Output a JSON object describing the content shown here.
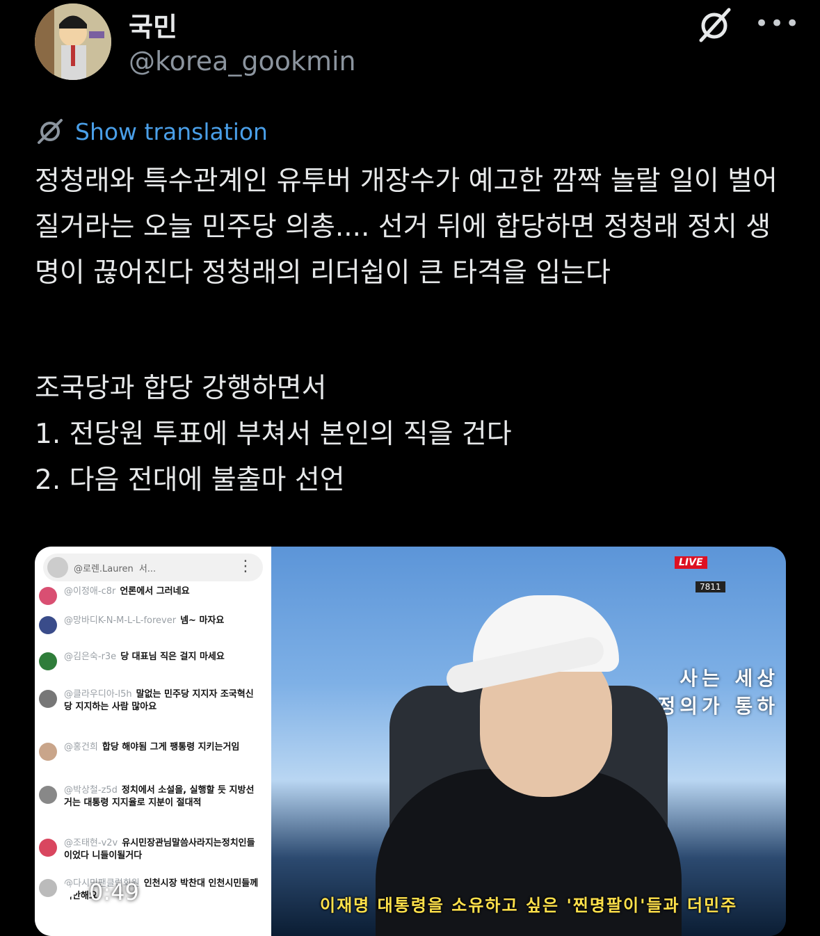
{
  "header": {
    "display_name": "국민",
    "handle": "@korea_gookmin",
    "more_icon": "more-dots-icon",
    "grok_icon": "grok-icon"
  },
  "translate": {
    "icon": "translate-icon",
    "label": "Show translation"
  },
  "tweet": {
    "paragraph1": "정청래와 특수관계인 유투버 개장수가 예고한 깜짝 놀랄 일이 벌어질거라는 오늘 민주당 의총.... 선거 뒤에 합당하면 정청래 정치 생명이 끊어진다 정청래의 리더쉽이 큰 타격을 입는다",
    "paragraph2_line1": "조국당과 합당 강행하면서",
    "paragraph2_line2": "1. 전당원 투표에 부쳐서 본인의 직을 건다",
    "paragraph2_line3": "2. 다음 전대에 불출마 선언"
  },
  "media": {
    "duration": "0:49",
    "chat": {
      "header_user": "@로렌.Lauren",
      "header_suffix": "서...",
      "messages": [
        {
          "user": "@이정애-c8r",
          "text": "언론에서 그러네요",
          "color": "#d94f72"
        },
        {
          "user": "@망바디K-N-M-L-L-forever",
          "text": "넴~ 마자요",
          "color": "#3a4c8a"
        },
        {
          "user": "@김은숙-r3e",
          "text": "당 대표님 직은 걸지 마세요",
          "color": "#2f7d3a"
        },
        {
          "user": "@클라우디아-l5h",
          "text": "말없는 민주당 지지자 조국혁신당 지지하는 사람 많아요",
          "color": "#777777"
        },
        {
          "user": "@홍건희",
          "text": "합당 해야됨 그게 팽통령 지키는거임",
          "color": "#c9a58a"
        },
        {
          "user": "@박상철-z5d",
          "text": "정치에서 소설을, 실행할 듯 지방선거는 대통령 지지율로 지분이 절대적",
          "color": "#888888"
        },
        {
          "user": "@조태현-v2v",
          "text": "유시민장관님말씀사라지는정치인들이었다 니들이될거다",
          "color": "#d9465f"
        },
        {
          "user": "@다시민팬클럽회원",
          "text": "인천시장 박찬대 인천시민들께 미안해요",
          "color": "#bbbbbb"
        }
      ]
    },
    "stream": {
      "live_label": "LIVE",
      "viewer_count": "7811",
      "banner_line1": "사는 세상",
      "banner_line2": "정의가 통하",
      "subtitle": "이재명 대통령을 소유하고 싶은 '찐명팔이'들과 더민주"
    }
  }
}
